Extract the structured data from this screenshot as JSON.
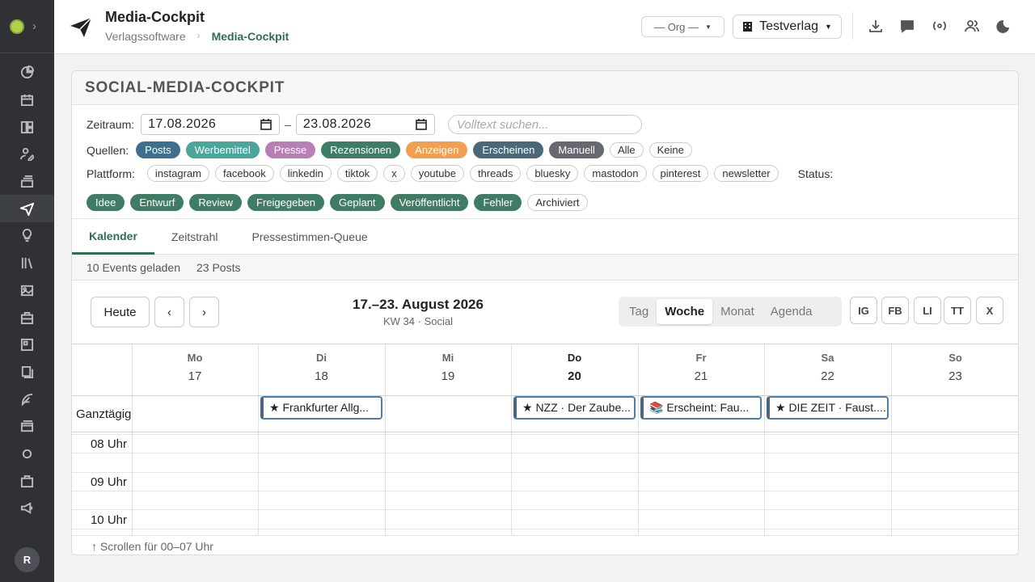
{
  "app": {
    "title": "Media-Cockpit",
    "breadcrumb": [
      "Verlagssoftware",
      "Media-Cockpit"
    ],
    "breadcrumb_sep": "›",
    "org_select": "— Org —",
    "verlag_select": "Testverlag",
    "user_initial": "R"
  },
  "sidebar": {
    "icons": [
      "pie-chart-icon",
      "calendar-icon",
      "layout-icon",
      "user-edit-icon",
      "inbox-icon",
      "paper-plane-icon",
      "lightbulb-icon",
      "library-icon",
      "image-icon",
      "briefcase-icon",
      "panel-icon",
      "book-icon",
      "feather-icon",
      "card-icon",
      "circle-icon",
      "suitcase-icon",
      "megaphone-icon"
    ],
    "active_index": 5
  },
  "cockpit": {
    "title": "SOCIAL-MEDIA-COCKPIT",
    "zeitraum_label": "Zeitraum:",
    "date_from": "17.08.2026",
    "date_to": "23.08.2026",
    "date_sep": "–",
    "search_placeholder": "Volltext suchen...",
    "quellen_label": "Quellen:",
    "quellen": [
      {
        "label": "Posts",
        "color": "#3e6f8e"
      },
      {
        "label": "Werbemittel",
        "color": "#4aa59a"
      },
      {
        "label": "Presse",
        "color": "#b77fb5"
      },
      {
        "label": "Rezensionen",
        "color": "#3e7d63"
      },
      {
        "label": "Anzeigen",
        "color": "#f0a050"
      },
      {
        "label": "Erscheinen",
        "color": "#4a6878"
      },
      {
        "label": "Manuell",
        "color": "#666a70"
      }
    ],
    "quellen_all": "Alle",
    "quellen_none": "Keine",
    "plattform_label": "Plattform:",
    "plattformen": [
      "instagram",
      "facebook",
      "linkedin",
      "tiktok",
      "x",
      "youtube",
      "threads",
      "bluesky",
      "mastodon",
      "pinterest",
      "newsletter"
    ],
    "status_label": "Status:",
    "status": [
      {
        "label": "Idee",
        "active": true
      },
      {
        "label": "Entwurf",
        "active": true
      },
      {
        "label": "Review",
        "active": true
      },
      {
        "label": "Freigegeben",
        "active": true
      },
      {
        "label": "Geplant",
        "active": true
      },
      {
        "label": "Veröffentlicht",
        "active": true
      },
      {
        "label": "Fehler",
        "active": true
      },
      {
        "label": "Archiviert",
        "active": false
      }
    ],
    "status_color": "#3e7d63"
  },
  "tabs": [
    "Kalender",
    "Zeitstrahl",
    "Pressestimmen-Queue"
  ],
  "stats": {
    "events": "10 Events geladen",
    "posts": "23 Posts"
  },
  "calendar": {
    "today_btn": "Heute",
    "prev": "‹",
    "next": "›",
    "title": "17.–23. August 2026",
    "subtitle": "KW 34 · Social",
    "views": [
      "Tag",
      "Woche",
      "Monat",
      "Agenda"
    ],
    "active_view": "Woche",
    "platform_filters": [
      "IG",
      "FB",
      "LI",
      "TT",
      "X"
    ],
    "days": [
      {
        "name": "Mo",
        "date": "17"
      },
      {
        "name": "Di",
        "date": "18"
      },
      {
        "name": "Mi",
        "date": "19"
      },
      {
        "name": "Do",
        "date": "20",
        "today": true
      },
      {
        "name": "Fr",
        "date": "21"
      },
      {
        "name": "Sa",
        "date": "22"
      },
      {
        "name": "So",
        "date": "23"
      }
    ],
    "allday_label": "Ganztägig",
    "allday_events": [
      {
        "day": 1,
        "text": "★ Frankfurter Allg..."
      },
      {
        "day": 3,
        "text": "★ NZZ · Der Zaube..."
      },
      {
        "day": 4,
        "text": "📚 Erscheint: Fau..."
      },
      {
        "day": 5,
        "text": "★ DIE ZEIT · Faust...."
      }
    ],
    "hours": [
      "08 Uhr",
      "09 Uhr",
      "10 Uhr"
    ],
    "footer": "↑ Scrollen für 00–07 Uhr"
  }
}
